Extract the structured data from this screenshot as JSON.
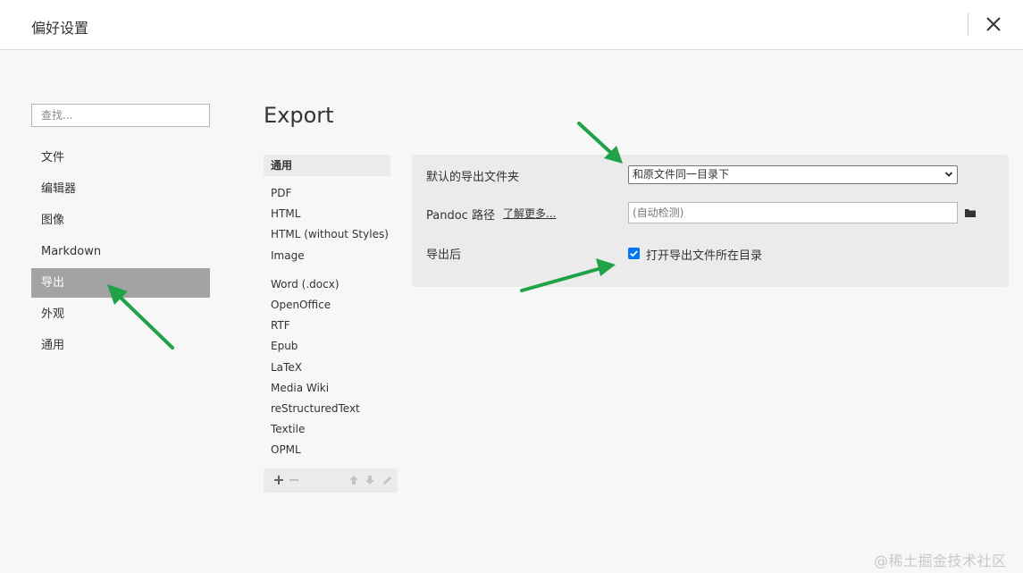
{
  "window": {
    "title": "偏好设置"
  },
  "search": {
    "placeholder": "查找..."
  },
  "sidebar": {
    "items": [
      {
        "label": "文件"
      },
      {
        "label": "编辑器"
      },
      {
        "label": "图像"
      },
      {
        "label": "Markdown"
      },
      {
        "label": "导出",
        "active": true
      },
      {
        "label": "外观"
      },
      {
        "label": "通用"
      }
    ]
  },
  "main": {
    "title": "Export"
  },
  "formats": {
    "header": "通用",
    "group1": [
      "PDF",
      "HTML",
      "HTML (without Styles)",
      "Image"
    ],
    "group2": [
      "Word (.docx)",
      "OpenOffice",
      "RTF",
      "Epub",
      "LaTeX",
      "Media Wiki",
      "reStructuredText",
      "Textile",
      "OPML"
    ],
    "toolbar_icons": [
      "plus-icon",
      "minus-icon",
      "arrow-up-icon",
      "arrow-down-icon",
      "pencil-icon"
    ]
  },
  "settings": {
    "export_folder": {
      "label": "默认的导出文件夹",
      "selected": "和原文件同一目录下"
    },
    "pandoc": {
      "label": "Pandoc 路径",
      "link": "了解更多...",
      "placeholder": "(自动检测)"
    },
    "after_export": {
      "label": "导出后",
      "checkbox_label": "打开导出文件所在目录",
      "checked": true
    }
  },
  "watermark": "@稀土掘金技术社区",
  "colors": {
    "accent": "#0075ff",
    "active_nav": "#a3a3a3",
    "annotation_arrow": "#1fa346"
  }
}
